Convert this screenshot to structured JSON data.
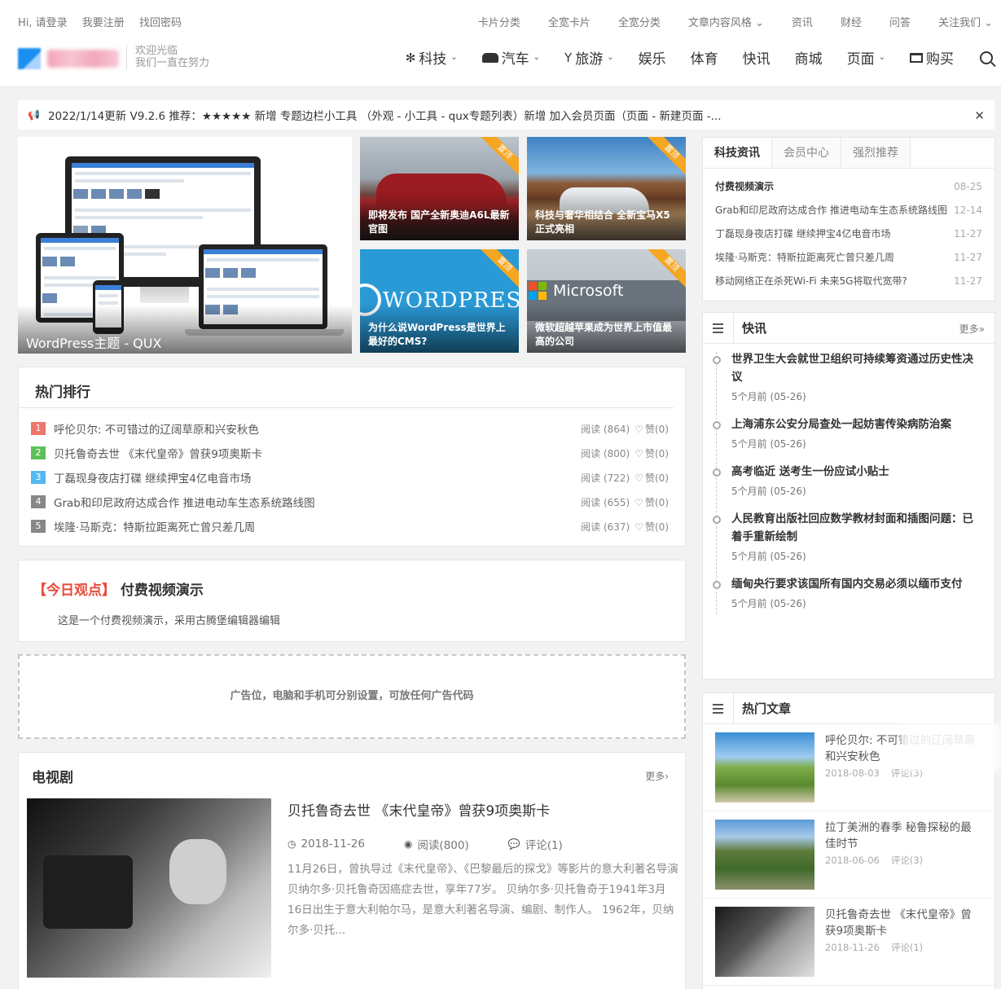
{
  "topbar": {
    "left": [
      "Hi, 请登录",
      "我要注册",
      "找回密码"
    ],
    "right": [
      "卡片分类",
      "全宽卡片",
      "全宽分类",
      "文章内容风格 ⌄",
      "资讯",
      "财经",
      "问答",
      "关注我们 ⌄"
    ]
  },
  "header": {
    "slogan1": "欢迎光临",
    "slogan2": "我们一直在努力",
    "nav": [
      {
        "label": "科技",
        "icon": "yelp-icon",
        "chev": "⌄"
      },
      {
        "label": "汽车",
        "icon": "car-icon",
        "chev": "⌄"
      },
      {
        "label": "旅游",
        "icon": "glass-icon",
        "chev": "⌄"
      },
      {
        "label": "娱乐"
      },
      {
        "label": "体育"
      },
      {
        "label": "快讯"
      },
      {
        "label": "商城"
      },
      {
        "label": "页面",
        "chev": "⌄"
      },
      {
        "label": "购买",
        "icon": "cart-icon"
      }
    ]
  },
  "notice": {
    "text": "2022/1/14更新 V9.2.6 推荐：★★★★★ 新增 专题边栏小工具 （外观 - 小工具 - qux专题列表）新增 加入会员页面（页面 - 新建页面 -..."
  },
  "slider": {
    "main_caption": "WordPress主题 - QUX",
    "tiles": [
      {
        "caption": "即将发布 国产全新奥迪A6L最新官图",
        "ribbon": "置顶"
      },
      {
        "caption": "科技与奢华相结合 全新宝马X5正式亮相",
        "ribbon": "置顶"
      },
      {
        "caption": "为什么说WordPress是世界上最好的CMS?",
        "ribbon": "置顶",
        "logo": "WORDPRES"
      },
      {
        "caption": "微软超越苹果成为世界上市值最高的公司",
        "ribbon": "置顶",
        "logo": "Microsoft"
      }
    ]
  },
  "sidebar": {
    "tabs": [
      "科技资讯",
      "会员中心",
      "强烈推荐"
    ],
    "news": [
      {
        "title": "付费视频演示",
        "date": "08-25"
      },
      {
        "title": "Grab和印尼政府达成合作 推进电动车生态系统路线图",
        "date": "12-14"
      },
      {
        "title": "丁磊现身夜店打碟 继续押宝4亿电音市场",
        "date": "11-27"
      },
      {
        "title": "埃隆·马斯克：特斯拉距离死亡曾只差几周",
        "date": "11-27"
      },
      {
        "title": "移动网络正在杀死Wi-Fi 未来5G将取代宽带?",
        "date": "11-27"
      }
    ],
    "flash": {
      "title": "快讯",
      "more": "更多»",
      "items": [
        {
          "title": "世界卫生大会就世卫组织可持续筹资通过历史性决议",
          "time": "5个月前 (05-26)"
        },
        {
          "title": "上海浦东公安分局查处一起妨害传染病防治案",
          "time": "5个月前 (05-26)"
        },
        {
          "title": "高考临近 送考生一份应试小贴士",
          "time": "5个月前 (05-26)"
        },
        {
          "title": "人民教育出版社回应数学教材封面和插图问题：已着手重新绘制",
          "time": "5个月前 (05-26)"
        },
        {
          "title": "缅甸央行要求该国所有国内交易必须以缅币支付",
          "time": "5个月前 (05-26)"
        }
      ]
    },
    "hot": {
      "title": "热门文章",
      "items": [
        {
          "title": "呼伦贝尔: 不可错过的辽阔草原和兴安秋色",
          "date": "2018-08-03",
          "comments": "评论(3)"
        },
        {
          "title": "拉丁美洲的春季 秘鲁探秘的最佳时节",
          "date": "2018-06-06",
          "comments": "评论(3)"
        },
        {
          "title": "贝托鲁奇去世 《末代皇帝》曾获9项奥斯卡",
          "date": "2018-11-26",
          "comments": "评论(1)"
        }
      ]
    }
  },
  "ranking": {
    "title": "热门排行",
    "items": [
      {
        "num": "1",
        "color": "#f0766b",
        "title": "呼伦贝尔: 不可错过的辽阔草原和兴安秋色",
        "views": "阅读 (864)",
        "likes": "赞(0)"
      },
      {
        "num": "2",
        "color": "#5ec05a",
        "title": "贝托鲁奇去世 《末代皇帝》曾获9项奥斯卡",
        "views": "阅读 (800)",
        "likes": "赞(0)"
      },
      {
        "num": "3",
        "color": "#55b9ef",
        "title": "丁磊现身夜店打碟 继续押宝4亿电音市场",
        "views": "阅读 (722)",
        "likes": "赞(0)"
      },
      {
        "num": "4",
        "color": "#888888",
        "title": "Grab和印尼政府达成合作 推进电动车生态系统路线图",
        "views": "阅读 (655)",
        "likes": "赞(0)"
      },
      {
        "num": "5",
        "color": "#888888",
        "title": "埃隆·马斯克：特斯拉距离死亡曾只差几周",
        "views": "阅读 (637)",
        "likes": "赞(0)"
      }
    ]
  },
  "viewpoint": {
    "tag": "【今日观点】",
    "title": "付费视频演示",
    "desc": "这是一个付费视频演示，采用古腾堡编辑器编辑"
  },
  "ad": {
    "text": "广告位，电脑和手机可分别设置，可放任何广告代码"
  },
  "tv": {
    "title": "电视剧",
    "more": "更多›",
    "post": {
      "title": "贝托鲁奇去世 《末代皇帝》曾获9项奥斯卡",
      "date": "2018-11-26",
      "views": "阅读(800)",
      "comments": "评论(1)",
      "excerpt": "11月26日，曾执导过《末代皇帝》、《巴黎最后的探戈》等影片的意大利著名导演贝纳尔多·贝托鲁奇因癌症去世，享年77岁。 贝纳尔多·贝托鲁奇于1941年3月16日出生于意大利帕尔马，是意大利著名导演、编剧、制作人。 1962年，贝纳尔多·贝托..."
    }
  },
  "colors": {
    "accent": "#e74c3c",
    "ribbon": "#f5a623"
  }
}
